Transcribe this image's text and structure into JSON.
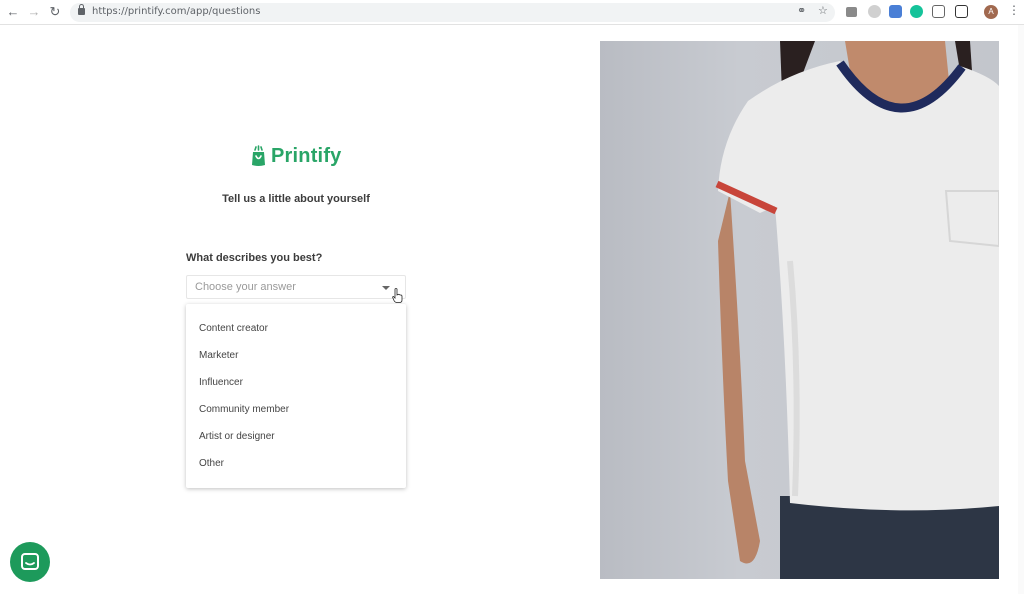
{
  "browser": {
    "url": "https://printify.com/app/questions",
    "avatar_initial": "A"
  },
  "brand": {
    "name": "Printify",
    "color": "#29a567"
  },
  "page": {
    "tagline": "Tell us a little about yourself",
    "question": "What describes you best?",
    "select": {
      "placeholder": "Choose your answer",
      "options": [
        "Content creator",
        "Marketer",
        "Influencer",
        "Community member",
        "Artist or designer",
        "Other"
      ]
    }
  },
  "icons": {
    "back": "back-arrow-icon",
    "forward": "forward-arrow-icon",
    "reload": "reload-icon",
    "lock": "lock-icon",
    "key": "key-icon",
    "star": "star-icon",
    "chat": "chat-icon"
  }
}
